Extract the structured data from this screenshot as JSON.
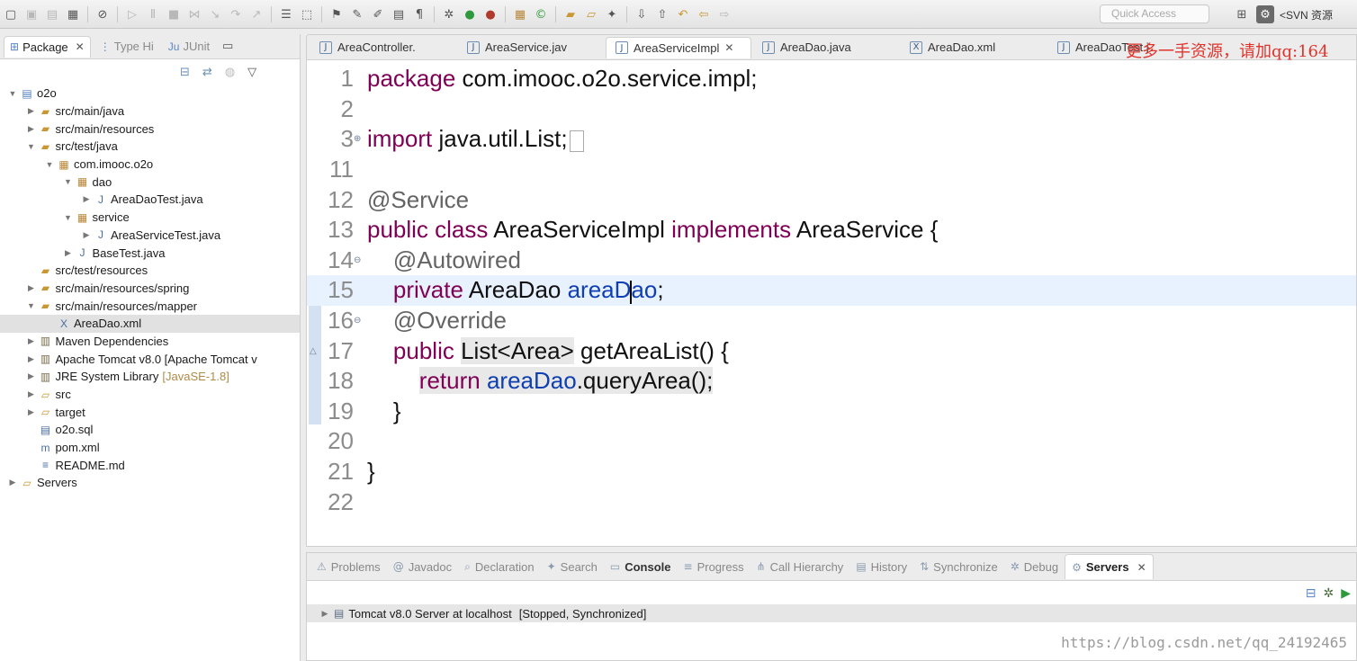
{
  "toolbar": {
    "quick_access_placeholder": "Quick Access",
    "perspective_label": "<SVN 资源"
  },
  "package_explorer": {
    "tabs": [
      {
        "label": "Package",
        "active": true
      },
      {
        "label": "Type Hi",
        "active": false
      },
      {
        "label": "JUnit",
        "active": false
      }
    ],
    "tree": [
      {
        "label": "o2o",
        "indent": 0,
        "expanded": true,
        "icon": "project-icon"
      },
      {
        "label": "src/main/java",
        "indent": 1,
        "expanded": false,
        "icon": "source-folder-icon"
      },
      {
        "label": "src/main/resources",
        "indent": 1,
        "expanded": false,
        "icon": "source-folder-icon"
      },
      {
        "label": "src/test/java",
        "indent": 1,
        "expanded": true,
        "icon": "source-folder-icon"
      },
      {
        "label": "com.imooc.o2o",
        "indent": 2,
        "expanded": true,
        "icon": "package-icon"
      },
      {
        "label": "dao",
        "indent": 3,
        "expanded": true,
        "icon": "package-icon"
      },
      {
        "label": "AreaDaoTest.java",
        "indent": 4,
        "expanded": false,
        "icon": "java-file-icon"
      },
      {
        "label": "service",
        "indent": 3,
        "expanded": true,
        "icon": "package-icon"
      },
      {
        "label": "AreaServiceTest.java",
        "indent": 4,
        "expanded": false,
        "icon": "java-file-icon"
      },
      {
        "label": "BaseTest.java",
        "indent": 3,
        "expanded": false,
        "icon": "java-file-icon"
      },
      {
        "label": "src/test/resources",
        "indent": 1,
        "expanded": null,
        "icon": "source-folder-icon"
      },
      {
        "label": "src/main/resources/spring",
        "indent": 1,
        "expanded": false,
        "icon": "source-folder-icon"
      },
      {
        "label": "src/main/resources/mapper",
        "indent": 1,
        "expanded": true,
        "icon": "source-folder-icon"
      },
      {
        "label": "AreaDao.xml",
        "indent": 2,
        "expanded": null,
        "icon": "xml-file-icon",
        "selected": true
      },
      {
        "label": "Maven Dependencies",
        "indent": 1,
        "expanded": false,
        "icon": "library-icon"
      },
      {
        "label": "Apache Tomcat v8.0 [Apache Tomcat v",
        "indent": 1,
        "expanded": false,
        "icon": "library-icon"
      },
      {
        "label": "JRE System Library",
        "decoration": "[JavaSE-1.8]",
        "indent": 1,
        "expanded": false,
        "icon": "library-icon"
      },
      {
        "label": "src",
        "indent": 1,
        "expanded": false,
        "icon": "folder-icon"
      },
      {
        "label": "target",
        "indent": 1,
        "expanded": false,
        "icon": "folder-icon"
      },
      {
        "label": "o2o.sql",
        "indent": 1,
        "expanded": null,
        "icon": "sql-file-icon"
      },
      {
        "label": "pom.xml",
        "indent": 1,
        "expanded": null,
        "icon": "maven-file-icon"
      },
      {
        "label": "README.md",
        "indent": 1,
        "expanded": null,
        "icon": "text-file-icon"
      },
      {
        "label": "Servers",
        "indent": 0,
        "expanded": false,
        "icon": "folder-icon"
      }
    ]
  },
  "editor": {
    "tabs": [
      {
        "label": "AreaController.",
        "active": false
      },
      {
        "label": "AreaService.jav",
        "active": false
      },
      {
        "label": "AreaServiceImpl",
        "active": true
      },
      {
        "label": "AreaDao.java",
        "active": false
      },
      {
        "label": "AreaDao.xml",
        "active": false
      },
      {
        "label": "AreaDaoTest.j",
        "active": false
      }
    ],
    "watermark": "更多一手资源，请加qq:164",
    "lines": [
      {
        "n": "1",
        "segments": [
          {
            "t": "package",
            "c": "kw"
          },
          {
            "t": " com.imooc.o2o.service.impl;",
            "c": ""
          }
        ]
      },
      {
        "n": "2",
        "segments": []
      },
      {
        "n": "3",
        "fold": "plus",
        "segments": [
          {
            "t": "import",
            "c": "kw"
          },
          {
            "t": " java.util.List;",
            "c": ""
          }
        ],
        "collapsed": true
      },
      {
        "n": "11",
        "segments": []
      },
      {
        "n": "12",
        "segments": [
          {
            "t": "@Service",
            "c": "ann"
          }
        ]
      },
      {
        "n": "13",
        "segments": [
          {
            "t": "public class",
            "c": "kw"
          },
          {
            "t": " AreaServiceImpl ",
            "c": ""
          },
          {
            "t": "implements",
            "c": "kw"
          },
          {
            "t": " AreaService {",
            "c": ""
          }
        ]
      },
      {
        "n": "14",
        "fold": "minus",
        "segments": [
          {
            "t": "    ",
            "c": ""
          },
          {
            "t": "@Autowired",
            "c": "ann"
          }
        ]
      },
      {
        "n": "15",
        "current": true,
        "segments": [
          {
            "t": "    ",
            "c": ""
          },
          {
            "t": "private",
            "c": "kw"
          },
          {
            "t": " AreaDao ",
            "c": ""
          },
          {
            "t": "areaD",
            "c": "fld"
          },
          {
            "t": "|",
            "c": "caret"
          },
          {
            "t": "ao",
            "c": "fld"
          },
          {
            "t": ";",
            "c": ""
          }
        ]
      },
      {
        "n": "16",
        "fold": "minus",
        "segments": [
          {
            "t": "    ",
            "c": ""
          },
          {
            "t": "@Override",
            "c": "ann"
          }
        ]
      },
      {
        "n": "17",
        "override": true,
        "segments": [
          {
            "t": "    ",
            "c": ""
          },
          {
            "t": "public",
            "c": "kw"
          },
          {
            "t": " ",
            "c": ""
          },
          {
            "t": "List<Area>",
            "c": "hl"
          },
          {
            "t": " getAreaList() {",
            "c": ""
          }
        ]
      },
      {
        "n": "18",
        "segments": [
          {
            "t": "        ",
            "c": ""
          },
          {
            "t": "return",
            "c": "kw hl"
          },
          {
            "t": " ",
            "c": "hl"
          },
          {
            "t": "areaDao",
            "c": "fld hl"
          },
          {
            "t": ".queryArea();",
            "c": "hl"
          }
        ]
      },
      {
        "n": "19",
        "segments": [
          {
            "t": "    }",
            "c": ""
          }
        ]
      },
      {
        "n": "20",
        "segments": []
      },
      {
        "n": "21",
        "segments": [
          {
            "t": "}",
            "c": ""
          }
        ]
      },
      {
        "n": "22",
        "segments": []
      }
    ]
  },
  "bottom_views": {
    "tabs": [
      {
        "label": "Problems",
        "icon": "problems-icon"
      },
      {
        "label": "Javadoc",
        "icon": "javadoc-icon"
      },
      {
        "label": "Declaration",
        "icon": "declaration-icon"
      },
      {
        "label": "Search",
        "icon": "search-icon"
      },
      {
        "label": "Console",
        "icon": "console-icon",
        "bold": true
      },
      {
        "label": "Progress",
        "icon": "progress-icon"
      },
      {
        "label": "Call Hierarchy",
        "icon": "call-hierarchy-icon"
      },
      {
        "label": "History",
        "icon": "history-icon"
      },
      {
        "label": "Synchronize",
        "icon": "synchronize-icon"
      },
      {
        "label": "Debug",
        "icon": "debug-icon"
      },
      {
        "label": "Servers",
        "icon": "servers-icon",
        "active": true
      }
    ],
    "server_entry": {
      "name": "Tomcat v8.0 Server at localhost",
      "status": "[Stopped, Synchronized]"
    },
    "watermark": "https://blog.csdn.net/qq_24192465"
  }
}
